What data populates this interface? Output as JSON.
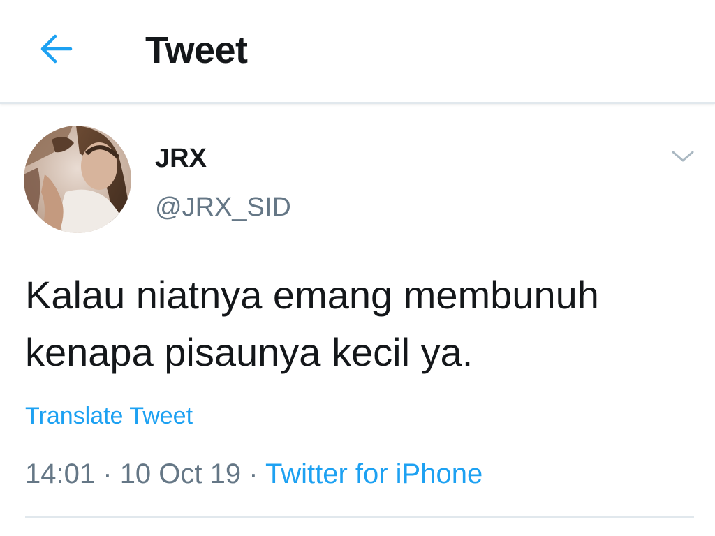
{
  "header": {
    "title": "Tweet",
    "back_icon": "arrow-left-icon"
  },
  "tweet": {
    "author": {
      "display_name": "JRX",
      "handle": "@JRX_SID",
      "avatar_icon": "profile-photo"
    },
    "menu_icon": "chevron-down-icon",
    "text": "Kalau niatnya emang membunuh\nkenapa pisaunya kecil ya.",
    "translate_label": "Translate Tweet",
    "time": "14:01",
    "separator": "·",
    "date": "10 Oct 19",
    "source": "Twitter for iPhone"
  },
  "colors": {
    "accent": "#1da1f2",
    "text_primary": "#14171a",
    "text_secondary": "#657786",
    "divider": "#e1e8ed"
  }
}
